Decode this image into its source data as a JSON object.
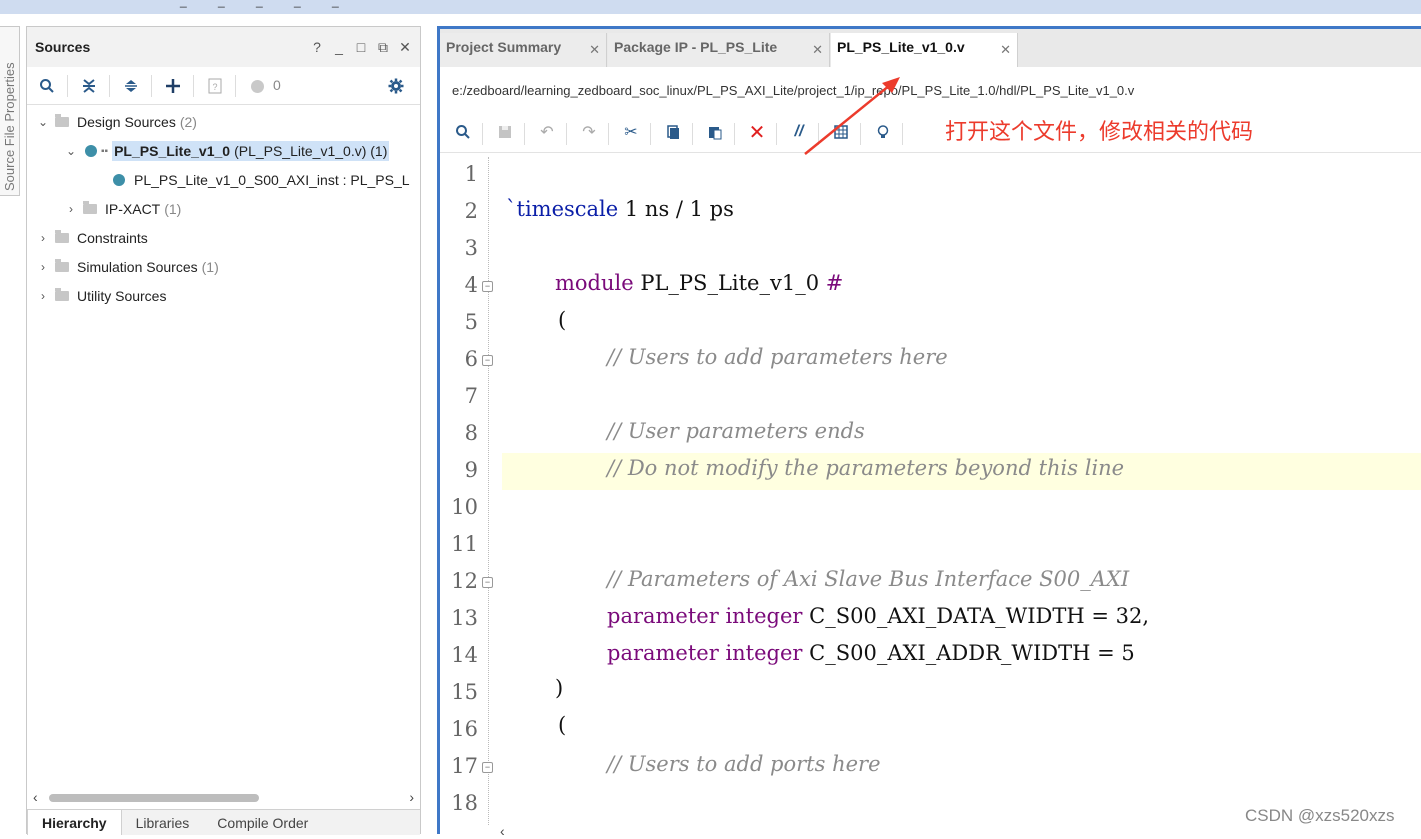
{
  "sources_panel": {
    "side_tab": "Source File Properties",
    "title": "Sources",
    "window_icons": [
      "?",
      "_",
      "□",
      "⧉",
      "✕"
    ],
    "toolbar_count": "0",
    "tree": {
      "design_sources": {
        "label": "Design Sources",
        "count": "(2)"
      },
      "top_module": {
        "label": "PL_PS_Lite_v1_0",
        "file": "(PL_PS_Lite_v1_0.v) (1)"
      },
      "inst": {
        "label": "PL_PS_Lite_v1_0_S00_AXI_inst : PL_PS_L"
      },
      "ipxact": {
        "label": "IP-XACT",
        "count": "(1)"
      },
      "constraints": {
        "label": "Constraints"
      },
      "sim_sources": {
        "label": "Simulation Sources",
        "count": "(1)"
      },
      "utility_sources": {
        "label": "Utility Sources"
      }
    },
    "bottom_tabs": [
      "Hierarchy",
      "Libraries",
      "Compile Order"
    ]
  },
  "editor": {
    "tabs": [
      "Project Summary",
      "Package IP - PL_PS_Lite",
      "PL_PS_Lite_v1_0.v"
    ],
    "active_tab": "PL_PS_Lite_v1_0.v",
    "file_path": "e:/zedboard/learning_zedboard_soc_linux/PL_PS_AXI_Lite/project_1/ip_repo/PL_PS_Lite_1.0/hdl/PL_PS_Lite_v1_0.v",
    "annotation": "打开这个文件，修改相关的代码",
    "annotation_color": "#ec3b2c",
    "highlight_line": 9,
    "lines": {
      "n": [
        "1",
        "2",
        "3",
        "4",
        "5",
        "6",
        "7",
        "8",
        "9",
        "10",
        "11",
        "12",
        "13",
        "14",
        "15",
        "16",
        "17",
        "18"
      ],
      "l2a": "`timescale",
      "l2b": " 1 ns / 1 ps",
      "l4a": "module",
      "l4b": " PL_PS_Lite_v1_0 ",
      "l4c": "#",
      "l5": "(",
      "l6": "// Users to add parameters here",
      "l8": "// User parameters ends",
      "l9": "// Do not modify the parameters beyond this line",
      "l12": "// Parameters of Axi Slave Bus Interface S00_AXI",
      "l13a": "parameter integer",
      "l13b": " C_S00_AXI_DATA_WIDTH = 32,",
      "l14a": "parameter integer",
      "l14b": " C_S00_AXI_ADDR_WIDTH = 5",
      "l15": ")",
      "l16": "(",
      "l17": "// Users to add ports here"
    }
  },
  "watermark": "CSDN @xzs520xzs"
}
